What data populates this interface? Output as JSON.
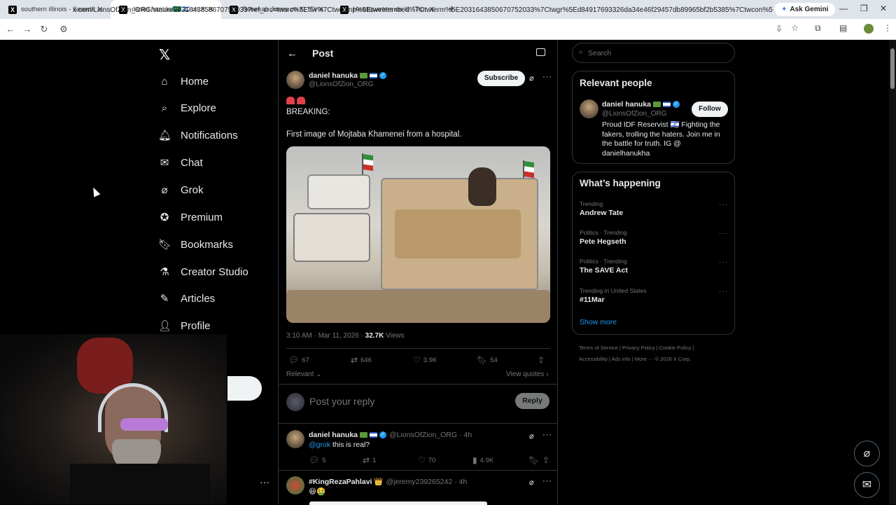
{
  "browser": {
    "tabs": [
      {
        "title": "southern illinois - Search / X",
        "active": false
      },
      {
        "title": "daniel hanuka🇸🇦🇮🇱 on X: \"🚨🚨",
        "active": true
      },
      {
        "title": "Rebekah Jones on X: \"CONFIRM",
        "active": false
      },
      {
        "title": "Headquarters on X: \"Trump: \"Yo",
        "active": false
      }
    ],
    "new_tab": "+",
    "ask_gemini": "Ask Gemini",
    "url": "x.com/LionsOfZion_ORG/status/2031643850670752033?ref_src=twsrc%5Etfw%7Ctwcamp%5Etweetembed%7Ctwterm%5E2031643850670752033%7Ctwgr%5Ed84917693326da34e46f29457db89965bf2b5385%7Ctwcon%5Es1_&ref_url=http%..."
  },
  "nav": {
    "items": [
      {
        "label": "Home",
        "icon": "home-icon"
      },
      {
        "label": "Explore",
        "icon": "search-icon"
      },
      {
        "label": "Notifications",
        "icon": "bell-icon"
      },
      {
        "label": "Chat",
        "icon": "mail-icon"
      },
      {
        "label": "Grok",
        "icon": "grok-icon"
      },
      {
        "label": "Premium",
        "icon": "verified-icon"
      },
      {
        "label": "Bookmarks",
        "icon": "bookmark-icon"
      },
      {
        "label": "Creator Studio",
        "icon": "flask-icon"
      },
      {
        "label": "Articles",
        "icon": "article-icon"
      },
      {
        "label": "Profile",
        "icon": "person-icon"
      }
    ]
  },
  "post": {
    "header_title": "Post",
    "author_name": "daniel hanuka",
    "author_handle": "@LionsOfZion_ORG",
    "subscribe_label": "Subscribe",
    "line1": "BREAKING:",
    "line2": "First image of Mojtaba Khamenei from a hospital.",
    "time": "3:10 AM · Mar 11, 2026 · ",
    "views_count": "32.7K",
    "views_label": " Views",
    "replies": "67",
    "reposts": "646",
    "likes": "3.9K",
    "bookmarks": "54",
    "relevant_label": "Relevant",
    "view_quotes": "View quotes",
    "reply_placeholder": "Post your reply",
    "reply_button": "Reply"
  },
  "replies": [
    {
      "name": "daniel hanuka",
      "handle": "@LionsOfZion_ORG",
      "time": "· 4h",
      "mention": "@grok",
      "text": " this is real?",
      "replies": "5",
      "reposts": "1",
      "likes": "70",
      "views": "4.9K"
    },
    {
      "name": "#KingRezaPahlavi 👑",
      "handle": "@jeremy239265242",
      "time": "· 4h",
      "text": "😆🤮"
    }
  ],
  "sidebar": {
    "search_placeholder": "Search",
    "relevant_people_title": "Relevant people",
    "person_name": "daniel hanuka",
    "person_handle": "@LionsOfZion_ORG",
    "follow_label": "Follow",
    "person_bio": "Proud IDF Reservist 🇮🇱 Fighting the fakers, trolling the haters. Join me in the battle for truth. IG @ danielhanukha",
    "whats_happening_title": "What’s happening",
    "trends": [
      {
        "category": "Trending",
        "name": "Andrew Tate"
      },
      {
        "category": "Politics · Trending",
        "name": "Pete Hegseth"
      },
      {
        "category": "Politics · Trending",
        "name": "The SAVE Act"
      },
      {
        "category": "Trending in United States",
        "name": "#11Mar"
      }
    ],
    "show_more": "Show more",
    "footer_line1": "Terms of Service  |  Privacy Policy  |  Cookie Policy  |",
    "footer_line2": "Accessibility  |  Ads info  |  More ···  © 2026 X Corp."
  },
  "colors": {
    "background": "#000000",
    "accent": "#1d9bf0",
    "text": "#e7e9ea",
    "muted": "#71767b",
    "border": "#2f3336"
  }
}
